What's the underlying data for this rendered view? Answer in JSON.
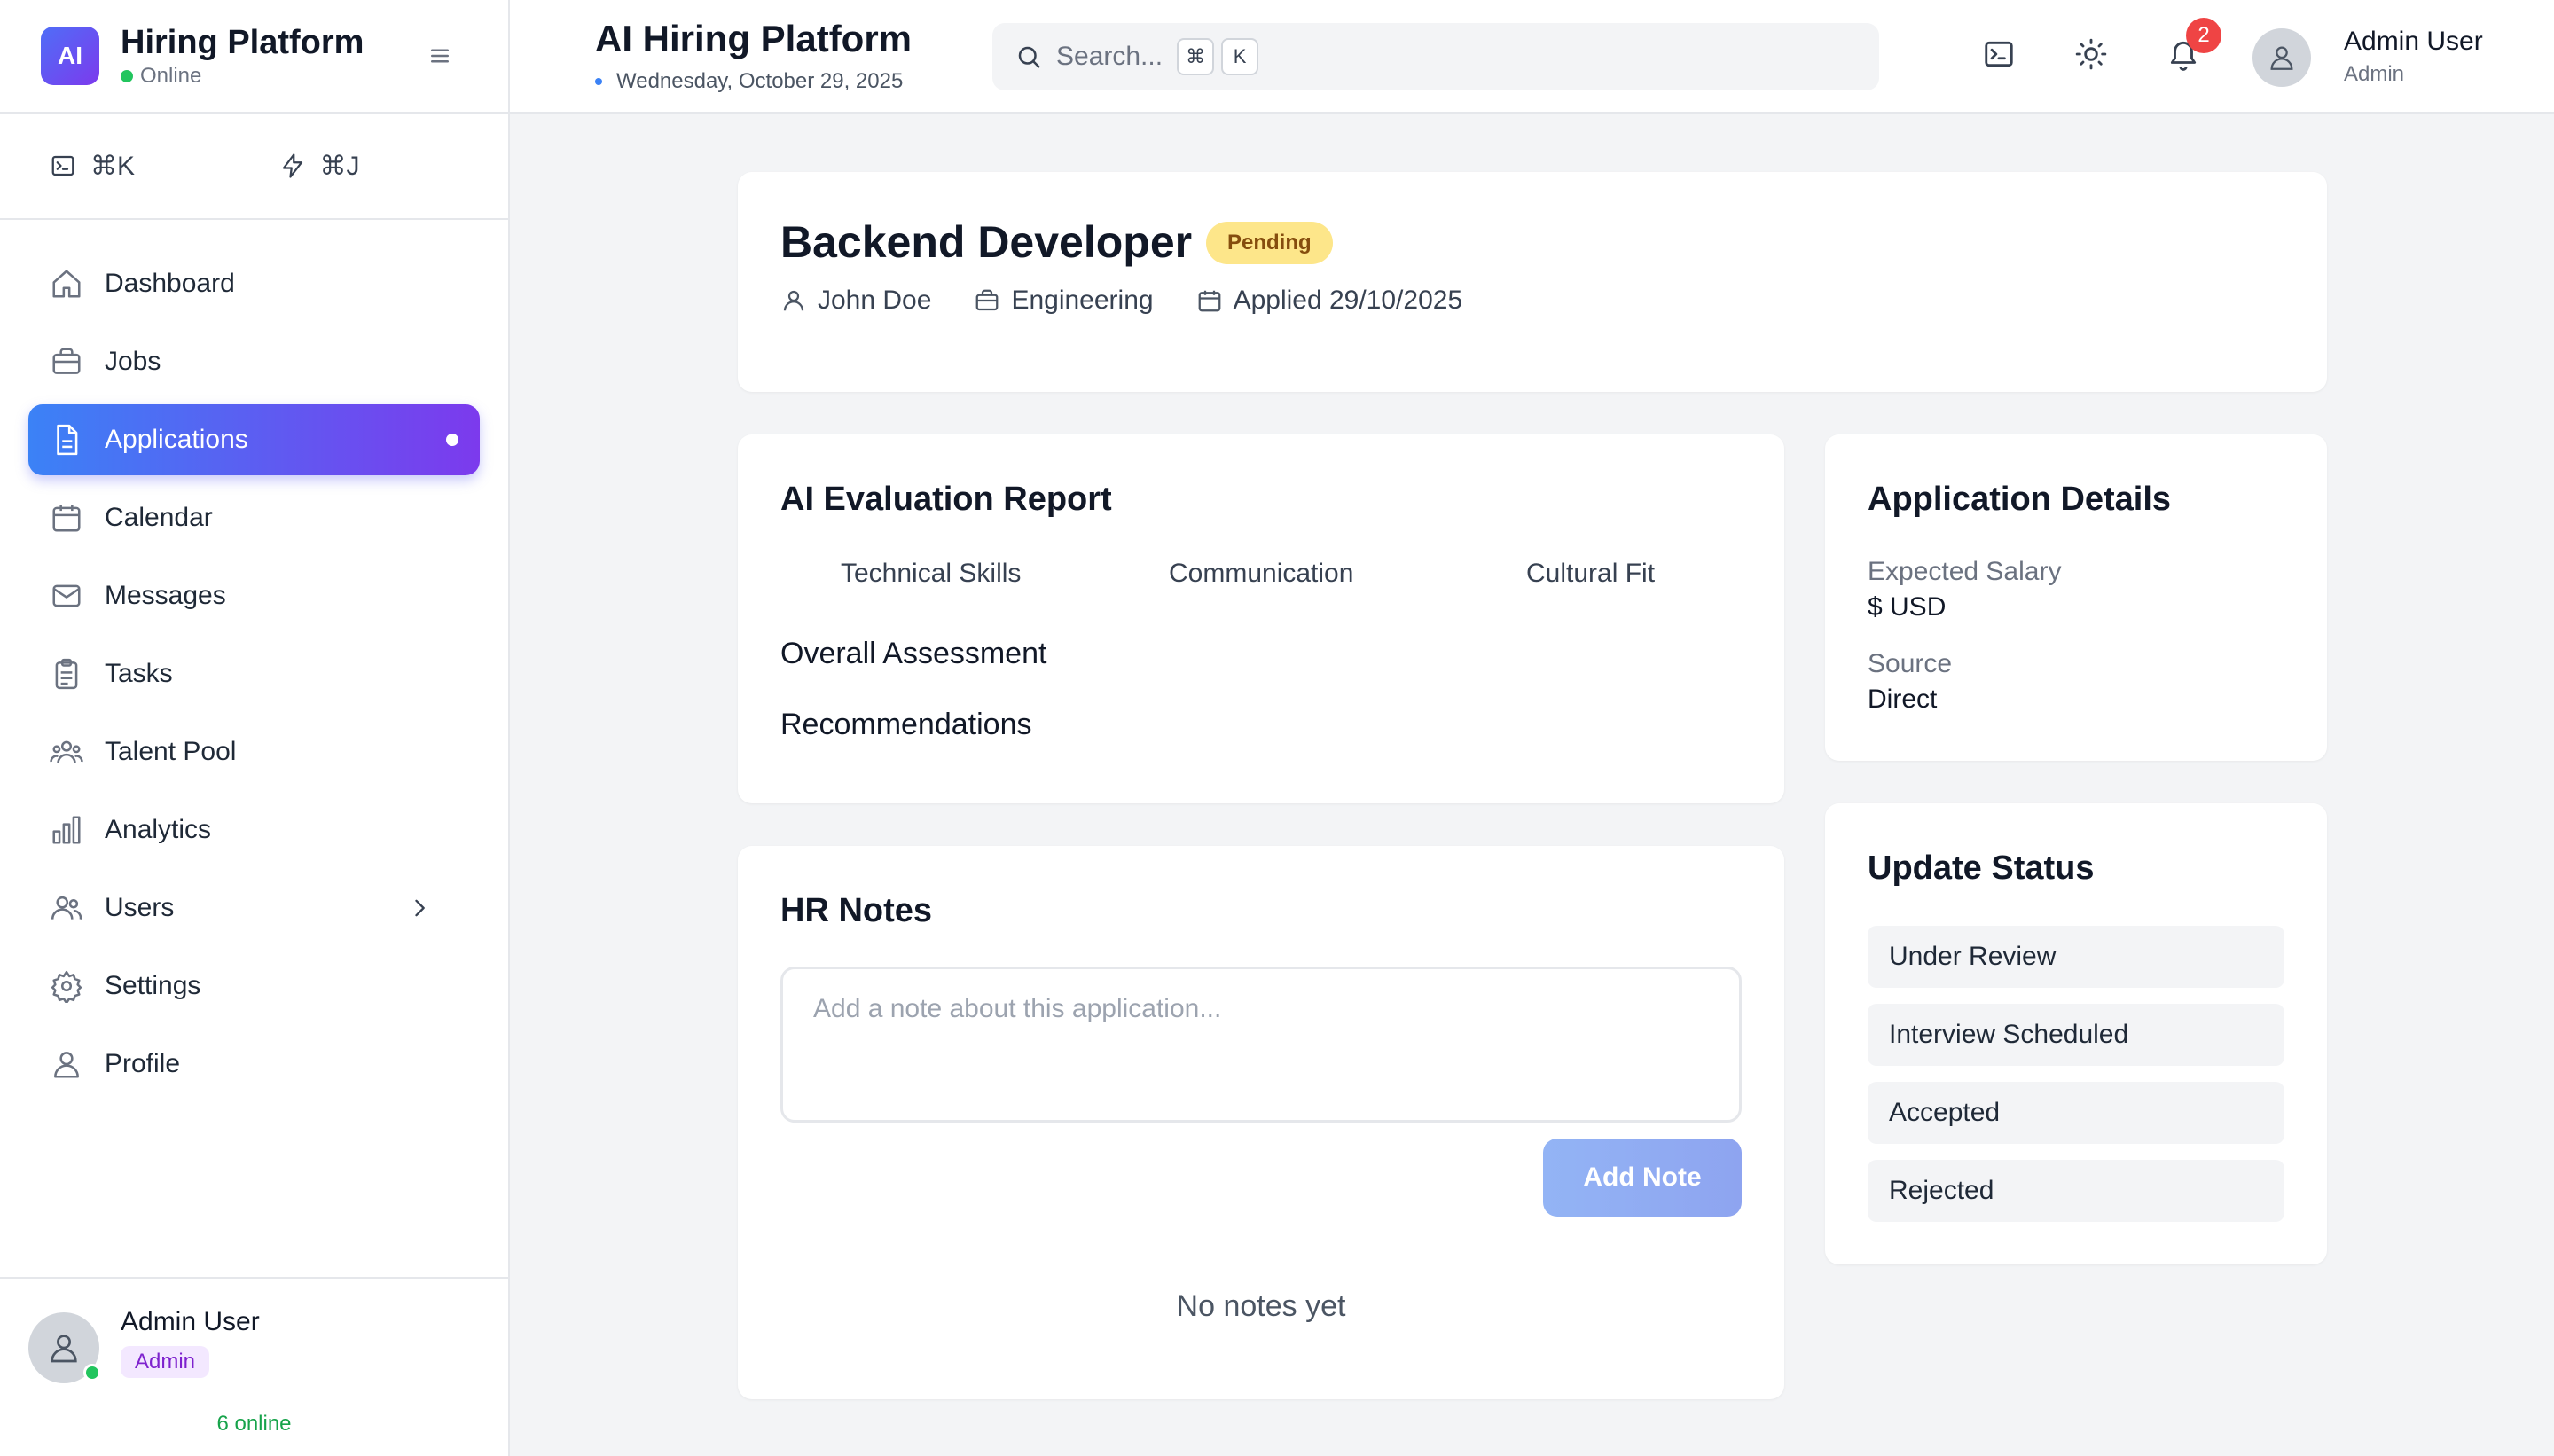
{
  "brand": {
    "logo": "AI",
    "name": "Hiring Platform",
    "status": "Online"
  },
  "shortcuts": [
    {
      "icon": "terminal-icon",
      "label": "⌘K"
    },
    {
      "icon": "lightning-icon",
      "label": "⌘J"
    }
  ],
  "nav": [
    {
      "label": "Dashboard",
      "icon": "home-icon"
    },
    {
      "label": "Jobs",
      "icon": "briefcase-icon"
    },
    {
      "label": "Applications",
      "icon": "document-icon",
      "active": true
    },
    {
      "label": "Calendar",
      "icon": "calendar-icon"
    },
    {
      "label": "Messages",
      "icon": "mail-icon"
    },
    {
      "label": "Tasks",
      "icon": "clipboard-icon"
    },
    {
      "label": "Talent Pool",
      "icon": "people-icon"
    },
    {
      "label": "Analytics",
      "icon": "bar-chart-icon"
    },
    {
      "label": "Users",
      "icon": "users-icon"
    },
    {
      "label": "Settings",
      "icon": "gear-icon"
    },
    {
      "label": "Profile",
      "icon": "user-icon"
    }
  ],
  "sidebar_footer": {
    "name": "Admin User",
    "role": "Admin",
    "online_count": "6 online"
  },
  "topbar": {
    "title": "AI Hiring Platform",
    "date": "Wednesday, October 29, 2025",
    "search_placeholder": "Search...",
    "kbd1": "⌘",
    "kbd2": "K",
    "notifications": "2",
    "user_name": "Admin User",
    "user_role": "Admin"
  },
  "application": {
    "title": "Backend Developer",
    "status": "Pending",
    "candidate": "John Doe",
    "department": "Engineering",
    "applied": "Applied 29/10/2025"
  },
  "evaluation": {
    "title": "AI Evaluation Report",
    "columns": [
      "Technical Skills",
      "Communication",
      "Cultural Fit"
    ],
    "overall": "Overall Assessment",
    "recommendations": "Recommendations"
  },
  "notes": {
    "title": "HR Notes",
    "placeholder": "Add a note about this application...",
    "button": "Add Note",
    "empty": "No notes yet"
  },
  "details": {
    "title": "Application Details",
    "salary_label": "Expected Salary",
    "salary_value": "$ USD",
    "source_label": "Source",
    "source_value": "Direct"
  },
  "update_status": {
    "title": "Update Status",
    "options": [
      "Under Review",
      "Interview Scheduled",
      "Accepted",
      "Rejected"
    ]
  },
  "colors": {
    "accent_start": "#3b82f6",
    "accent_end": "#7c3aed",
    "pending_bg": "#fde68a",
    "online": "#22c55e",
    "notification": "#ef4444"
  }
}
